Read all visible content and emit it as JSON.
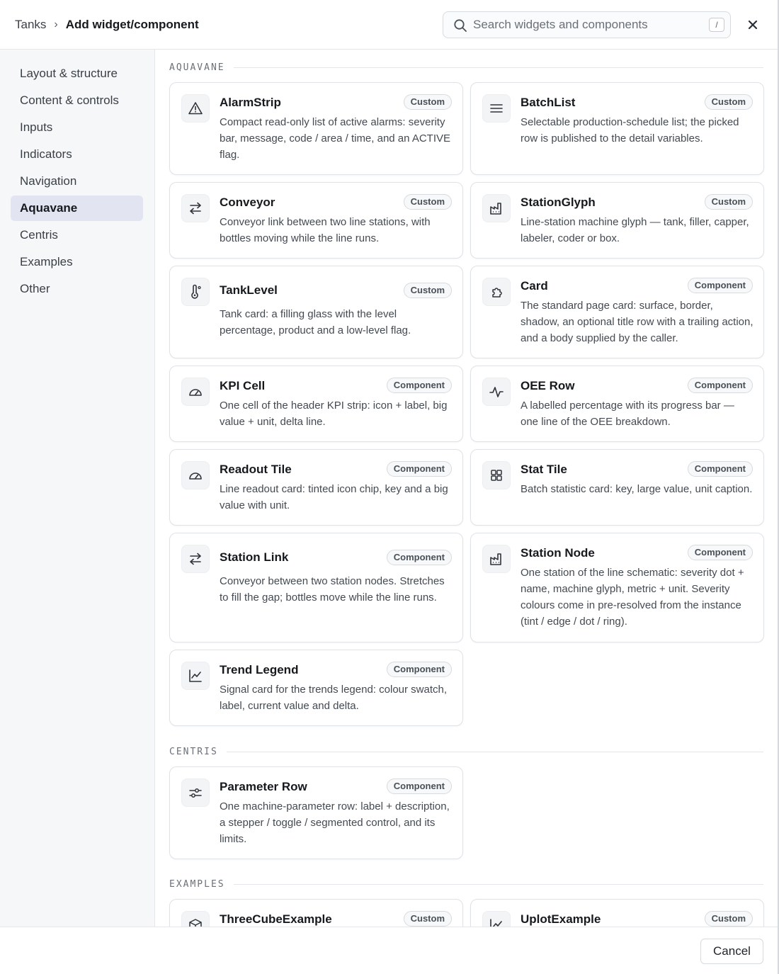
{
  "header": {
    "breadcrumb_parent": "Tanks",
    "breadcrumb_separator": "›",
    "breadcrumb_current": "Add widget/component",
    "search_placeholder": "Search widgets and components",
    "search_shortcut": "/",
    "close_icon": "close-icon"
  },
  "sidebar": {
    "items": [
      {
        "label": "Layout & structure",
        "active": false
      },
      {
        "label": "Content & controls",
        "active": false
      },
      {
        "label": "Inputs",
        "active": false
      },
      {
        "label": "Indicators",
        "active": false
      },
      {
        "label": "Navigation",
        "active": false
      },
      {
        "label": "Aquavane",
        "active": true
      },
      {
        "label": "Centris",
        "active": false
      },
      {
        "label": "Examples",
        "active": false
      },
      {
        "label": "Other",
        "active": false
      }
    ]
  },
  "sections": [
    {
      "title": "AQUAVANE"
    },
    {
      "title": "CENTRIS"
    },
    {
      "title": "EXAMPLES"
    }
  ],
  "cards": [
    {
      "title": "AlarmStrip",
      "badge": "Custom",
      "icon": "warning-triangle-icon",
      "desc": "Compact read-only list of active alarms: severity bar, message, code / area / time, and an ACTIVE flag."
    },
    {
      "title": "BatchList",
      "badge": "Custom",
      "icon": "list-lines-icon",
      "desc": "Selectable production-schedule list; the picked row is published to the detail variables."
    },
    {
      "title": "Conveyor",
      "badge": "Custom",
      "icon": "swap-arrows-icon",
      "desc": "Conveyor link between two line stations, with bottles moving while the line runs."
    },
    {
      "title": "StationGlyph",
      "badge": "Custom",
      "icon": "factory-icon",
      "desc": "Line-station machine glyph — tank, filler, capper, labeler, coder or box."
    },
    {
      "title": "TankLevel",
      "badge": "Custom",
      "icon": "thermometer-icon",
      "desc": "Tank card: a filling glass with the level percentage, product and a low-level flag."
    },
    {
      "title": "Card",
      "badge": "Component",
      "icon": "puzzle-icon",
      "desc": "The standard page card: surface, border, shadow, an optional title row with a trailing action, and a body supplied by the caller."
    },
    {
      "title": "KPI Cell",
      "badge": "Component",
      "icon": "gauge-icon",
      "desc": "One cell of the header KPI strip: icon + label, big value + unit, delta line."
    },
    {
      "title": "OEE Row",
      "badge": "Component",
      "icon": "activity-icon",
      "desc": "A labelled percentage with its progress bar — one line of the OEE breakdown."
    },
    {
      "title": "Readout Tile",
      "badge": "Component",
      "icon": "gauge-icon",
      "desc": "Line readout card: tinted icon chip, key and a big value with unit."
    },
    {
      "title": "Stat Tile",
      "badge": "Component",
      "icon": "grid-icon",
      "desc": "Batch statistic card: key, large value, unit caption."
    },
    {
      "title": "Station Link",
      "badge": "Component",
      "icon": "swap-arrows-icon",
      "desc": "Conveyor between two station nodes. Stretches to fill the gap; bottles move while the line runs."
    },
    {
      "title": "Station Node",
      "badge": "Component",
      "icon": "factory-icon",
      "desc": "One station of the line schematic: severity dot + name, machine glyph, metric + unit. Severity colours come in pre-resolved from the instance (tint / edge / dot / ring)."
    },
    {
      "title": "Trend Legend",
      "badge": "Component",
      "icon": "line-chart-icon",
      "desc": "Signal card for the trends legend: colour swatch, label, current value and delta."
    },
    {
      "title": "Parameter Row",
      "badge": "Component",
      "icon": "sliders-icon",
      "desc": "One machine-parameter row: label + description, a stepper / toggle / segmented control, and its limits."
    },
    {
      "title": "ThreeCubeExample",
      "badge": "Custom",
      "icon": "cube-icon",
      "desc": ""
    },
    {
      "title": "UplotExample",
      "badge": "Custom",
      "icon": "line-chart-icon",
      "desc": ""
    }
  ],
  "footer": {
    "cancel_label": "Cancel"
  },
  "colors": {
    "sidebar_bg": "#f6f7f8",
    "active_item_bg": "#e3e4f2",
    "border": "#dfe2e6",
    "text_primary": "#16191d",
    "text_secondary": "#444a52"
  }
}
